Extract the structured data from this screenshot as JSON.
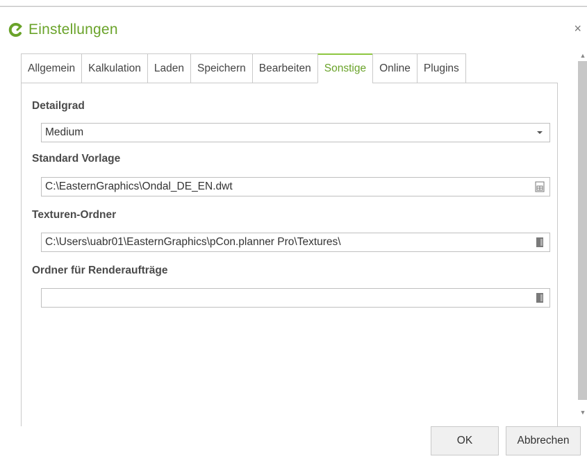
{
  "dialog": {
    "title": "Einstellungen",
    "close_symbol": "×"
  },
  "tabs": [
    {
      "label": "Allgemein"
    },
    {
      "label": "Kalkulation"
    },
    {
      "label": "Laden"
    },
    {
      "label": "Speichern"
    },
    {
      "label": "Bearbeiten"
    },
    {
      "label": "Sonstige",
      "active": true
    },
    {
      "label": "Online"
    },
    {
      "label": "Plugins"
    }
  ],
  "settings": {
    "detail": {
      "label": "Detailgrad",
      "value": "Medium"
    },
    "template": {
      "label": "Standard Vorlage",
      "value": "C:\\EasternGraphics\\Ondal_DE_EN.dwt"
    },
    "textures": {
      "label": "Texturen-Ordner",
      "value": "C:\\Users\\uabr01\\EasternGraphics\\pCon.planner Pro\\Textures\\"
    },
    "render": {
      "label": "Ordner für Renderaufträge",
      "value": ""
    }
  },
  "buttons": {
    "ok": "OK",
    "cancel": "Abbrechen"
  },
  "colors": {
    "accent": "#6aa32a",
    "tab_highlight": "#8dc63f"
  },
  "icons": {
    "logo": "pcon-logo-icon",
    "dropdown": "chevron-down-icon",
    "file_browse": "file-browse-icon",
    "folder_browse": "folder-browse-icon"
  }
}
